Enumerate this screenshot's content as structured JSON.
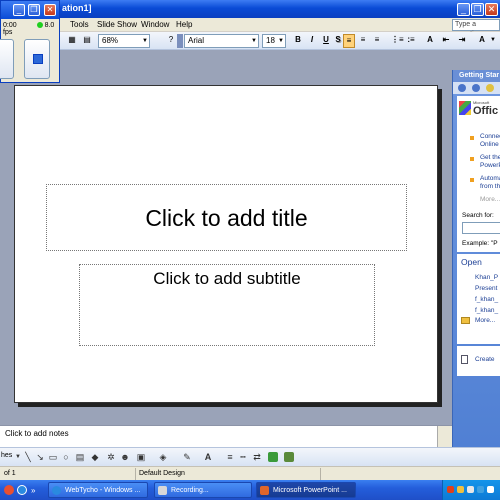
{
  "app": {
    "title_fragment": "ation1]",
    "colors": {
      "titlebar": "#0a4bd6",
      "taskpane": "#5b86d6",
      "accent_orange": "#f0a020"
    }
  },
  "recorder": {
    "time": "0:00",
    "fps": "8.0 fps"
  },
  "menu": {
    "items": [
      "Tools",
      "Slide Show",
      "Window",
      "Help"
    ],
    "help_placeholder": "Type a question"
  },
  "toolbar": {
    "zoom": "68%",
    "font_name": "Arial",
    "font_size": "18",
    "bold": "B",
    "italic": "I",
    "underline": "U",
    "shadow": "S",
    "font_color": "A"
  },
  "slide": {
    "title_placeholder": "Click to add title",
    "subtitle_placeholder": "Click to add subtitle"
  },
  "notes": {
    "placeholder": "Click to add notes"
  },
  "taskpane": {
    "header": "Getting Star",
    "office_logo": "Offic",
    "office_logo_small": "Microsoft",
    "links": [
      "Connec",
      "Online",
      "Get the",
      "PowerP",
      "Automa",
      "from th"
    ],
    "more": "More...",
    "search_label": "Search for:",
    "example": "Example: \"P",
    "open_title": "Open",
    "recent_files": [
      "Khan_P",
      "Present",
      "f_khan_",
      "f_khan_"
    ],
    "open_more": "More...",
    "create": "Create"
  },
  "drawbar": {
    "draw_label": "hes"
  },
  "status": {
    "slide": "of 1",
    "design": "Default Design"
  },
  "taskbar": {
    "items": [
      {
        "label": "WebTycho - Windows ...",
        "active": false
      },
      {
        "label": "Recording...",
        "active": false
      },
      {
        "label": "Microsoft PowerPoint ...",
        "active": true
      }
    ]
  }
}
